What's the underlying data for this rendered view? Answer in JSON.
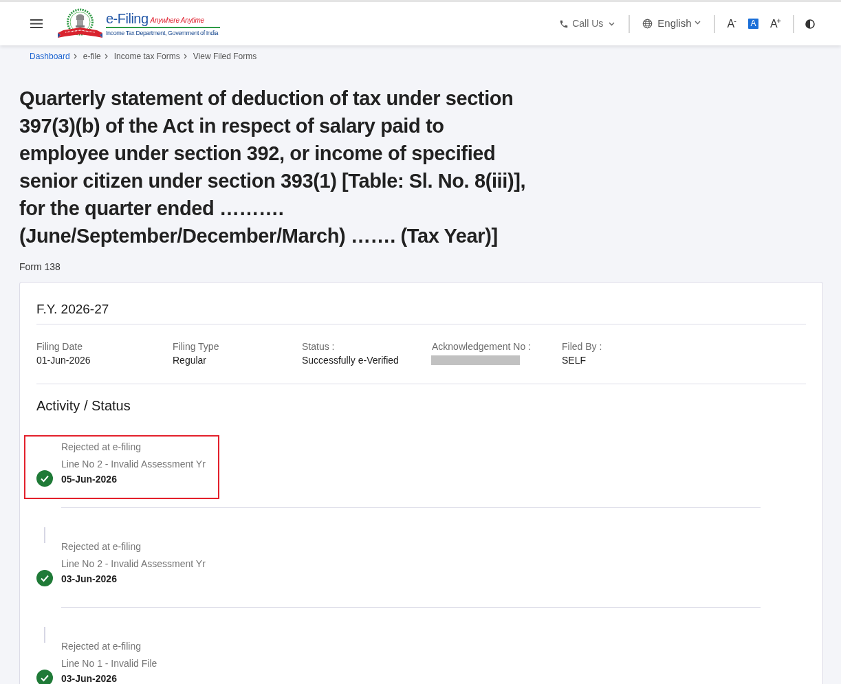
{
  "header": {
    "logo": {
      "title": "e-Filing",
      "tagline": "Anywhere Anytime",
      "subtitle": "Income Tax Department, Government of India"
    },
    "call_us": {
      "label": "Call Us"
    },
    "language": {
      "label": "English"
    },
    "font_controls": [
      {
        "label": "A$^{-}$",
        "selected": false
      },
      {
        "label": "A",
        "selected": true
      },
      {
        "label": "A$^{+}$",
        "selected": false
      }
    ]
  },
  "breadcrumb": [
    {
      "label": "Dashboard",
      "kind": "link"
    },
    {
      "label": "e-file",
      "kind": "plain"
    },
    {
      "label": "Income tax Forms",
      "kind": "plain"
    },
    {
      "label": "View Filed Forms",
      "kind": "plain"
    }
  ],
  "page": {
    "title": "Quarterly statement of deduction of tax under section 397(3)(b) of the Act in respect of salary paid to employee under section 392, or income of specified senior citizen under section 393(1) [Table: Sl. No. 8(iii)], for the quarter ended ………. (June/September/December/March) ……. (Tax Year)]",
    "form": "Form 138"
  },
  "card": {
    "heading": "F.Y. 2026-27",
    "fields": [
      {
        "label": "Filing Date",
        "value": "01-Jun-2026",
        "kind": "text"
      },
      {
        "label": "Filing Type",
        "value": "Regular",
        "kind": "text"
      },
      {
        "label": "Status :",
        "value": "Successfully e-Verified",
        "kind": "text"
      },
      {
        "label": "Acknowledgement No :",
        "kind": "redacted"
      },
      {
        "label": "Filed By :",
        "value": "SELF",
        "kind": "text"
      }
    ],
    "activity": {
      "heading": "Activity / Status",
      "items": [
        {
          "status": "Rejected at e-filing",
          "detail": "Line No 2 - Invalid Assessment Yr",
          "date": "05-Jun-2026",
          "highlighted": true
        },
        {
          "status": "Rejected at e-filing",
          "detail": "Line No 2 - Invalid Assessment Yr",
          "date": "03-Jun-2026",
          "highlighted": false
        },
        {
          "status": "Rejected at e-filing",
          "detail": "Line No 1 - Invalid File",
          "date": "03-Jun-2026",
          "highlighted": false
        }
      ]
    }
  }
}
